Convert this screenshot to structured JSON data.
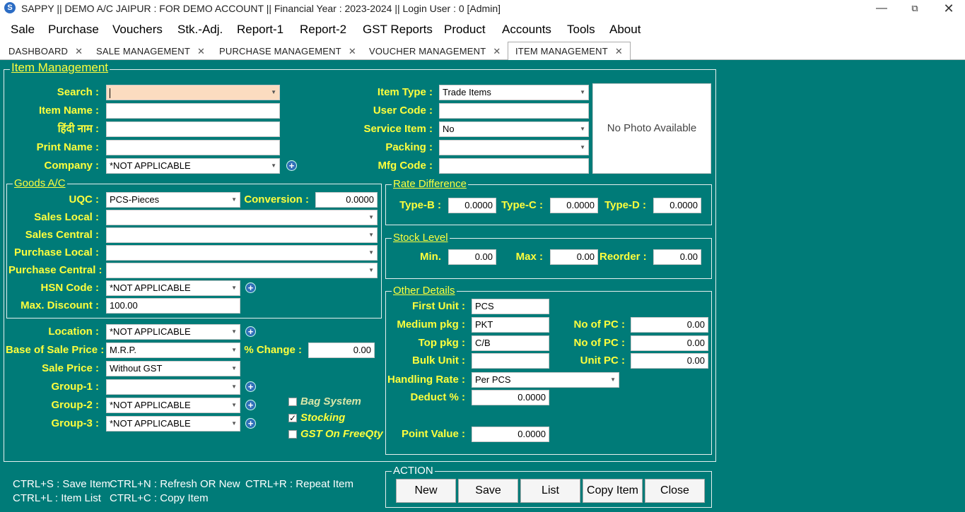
{
  "window": {
    "title": "SAPPY || DEMO A/C JAIPUR : FOR DEMO ACCOUNT || Financial Year : 2023-2024 || Login User : 0 [Admin]",
    "icon": "app-logo-icon"
  },
  "menu": [
    "Sale",
    "Purchase",
    "Vouchers",
    "Stk.-Adj.",
    "Report-1",
    "Report-2",
    "GST Reports",
    "Product",
    "Accounts",
    "Tools",
    "About"
  ],
  "tabs": [
    {
      "label": "DASHBOARD",
      "active": false
    },
    {
      "label": "SALE MANAGEMENT",
      "active": false
    },
    {
      "label": "PURCHASE MANAGEMENT",
      "active": false
    },
    {
      "label": "VOUCHER MANAGEMENT",
      "active": false
    },
    {
      "label": "ITEM MANAGEMENT",
      "active": true
    }
  ],
  "item_management": {
    "legend": "Item Management",
    "search": {
      "label": "Search :",
      "value": ""
    },
    "item_name": {
      "label": "Item Name :",
      "value": ""
    },
    "hindi_name": {
      "label": "हिंदी नाम :",
      "value": ""
    },
    "print_name": {
      "label": "Print Name :",
      "value": ""
    },
    "company": {
      "label": "Company :",
      "value": "*NOT APPLICABLE"
    },
    "item_type": {
      "label": "Item Type :",
      "value": "Trade Items"
    },
    "user_code": {
      "label": "User Code :",
      "value": ""
    },
    "service_item": {
      "label": "Service Item :",
      "value": "No"
    },
    "packing": {
      "label": "Packing :",
      "value": ""
    },
    "mfg_code": {
      "label": "Mfg Code :",
      "value": ""
    },
    "photo": "No Photo Available"
  },
  "goods_ac": {
    "legend": "Goods A/C",
    "uqc": {
      "label": "UQC :",
      "value": "PCS-Pieces"
    },
    "conversion": {
      "label": "Conversion :",
      "value": "0.0000"
    },
    "sales_local": {
      "label": "Sales Local :",
      "value": ""
    },
    "sales_central": {
      "label": "Sales Central :",
      "value": ""
    },
    "purchase_local": {
      "label": "Purchase Local :",
      "value": ""
    },
    "purchase_central": {
      "label": "Purchase Central :",
      "value": ""
    },
    "hsn_code": {
      "label": "HSN Code :",
      "value": "*NOT APPLICABLE"
    },
    "max_discount": {
      "label": "Max. Discount :",
      "value": "100.00"
    }
  },
  "lower_left": {
    "location": {
      "label": "Location :",
      "value": "*NOT APPLICABLE"
    },
    "base_of_sale_price": {
      "label": "Base of Sale Price :",
      "value": "M.R.P."
    },
    "pct_change": {
      "label": "% Change :",
      "value": "0.00"
    },
    "sale_price": {
      "label": "Sale Price :",
      "value": "Without GST"
    },
    "group1": {
      "label": "Group-1 :",
      "value": ""
    },
    "group2": {
      "label": "Group-2 :",
      "value": "*NOT APPLICABLE"
    },
    "group3": {
      "label": "Group-3 :",
      "value": "*NOT APPLICABLE"
    },
    "bag_system": {
      "label": "Bag System",
      "checked": false
    },
    "stocking": {
      "label": "Stocking",
      "checked": true
    },
    "gst_on_freeqty": {
      "label": "GST On FreeQty",
      "checked": false
    }
  },
  "rate_difference": {
    "legend": "Rate Difference",
    "type_b": {
      "label": "Type-B :",
      "value": "0.0000"
    },
    "type_c": {
      "label": "Type-C :",
      "value": "0.0000"
    },
    "type_d": {
      "label": "Type-D :",
      "value": "0.0000"
    }
  },
  "stock_level": {
    "legend": "Stock Level",
    "min": {
      "label": "Min.",
      "value": "0.00"
    },
    "max": {
      "label": "Max :",
      "value": "0.00"
    },
    "reorder": {
      "label": "Reorder :",
      "value": "0.00"
    }
  },
  "other_details": {
    "legend": "Other Details",
    "first_unit": {
      "label": "First Unit :",
      "value": "PCS"
    },
    "medium_pkg": {
      "label": "Medium pkg :",
      "value": "PKT"
    },
    "medium_no_of_pc": {
      "label": "No of PC :",
      "value": "0.00"
    },
    "top_pkg": {
      "label": "Top pkg :",
      "value": "C/B"
    },
    "top_no_of_pc": {
      "label": "No of PC :",
      "value": "0.00"
    },
    "bulk_unit": {
      "label": "Bulk Unit :",
      "value": ""
    },
    "unit_pc": {
      "label": "Unit PC :",
      "value": "0.00"
    },
    "handling_rate": {
      "label": "Handling Rate :",
      "value": "Per PCS"
    },
    "deduct_pct": {
      "label": "Deduct % :",
      "value": "0.0000"
    },
    "point_value": {
      "label": "Point Value :",
      "value": "0.0000"
    }
  },
  "action": {
    "legend": "ACTION",
    "buttons": [
      "New",
      "Save",
      "List",
      "Copy Item",
      "Close"
    ]
  },
  "hints": {
    "line1a": "CTRL+S : Save Item",
    "line1b": "CTRL+N : Refresh OR New",
    "line1c": "CTRL+R : Repeat Item",
    "line2a": "CTRL+L : Item List",
    "line2b": "CTRL+C : Copy Item"
  }
}
